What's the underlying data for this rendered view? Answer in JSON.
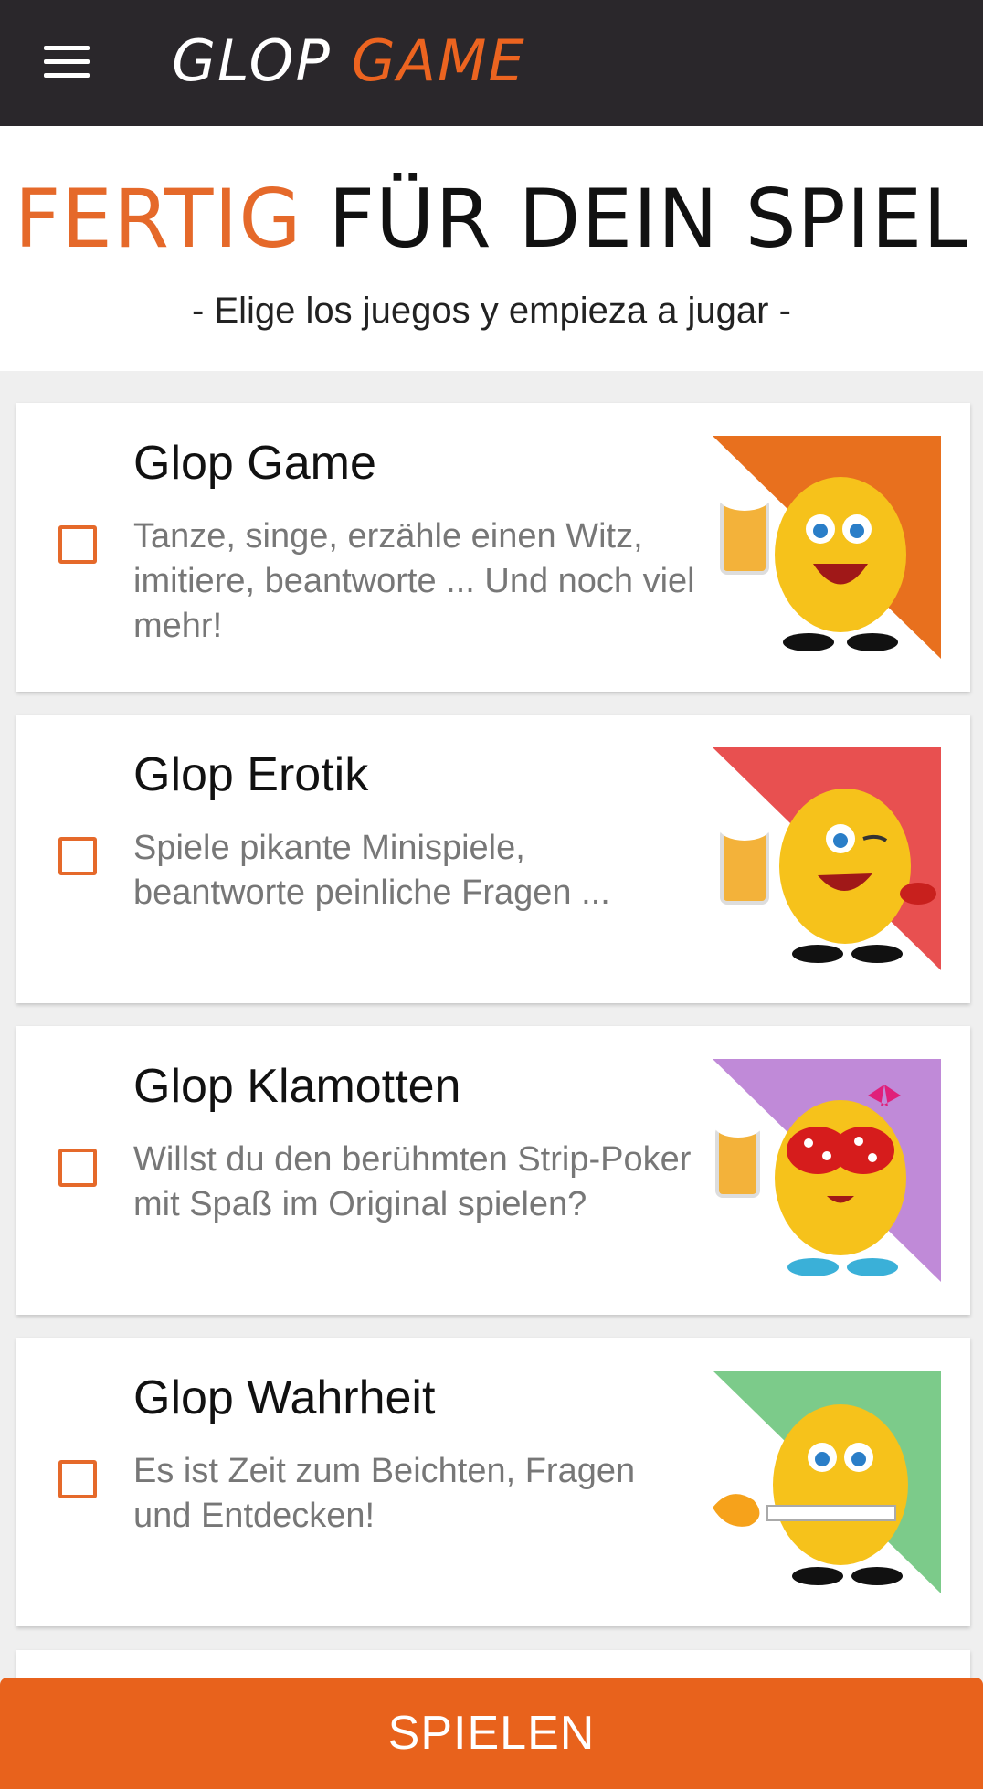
{
  "app": {
    "logo_white": "GLOP",
    "logo_orange": "GAME"
  },
  "header": {
    "title_highlight": "FERTIG",
    "title_rest": "FÜR DEIN SPIEL",
    "subtitle": "- Elige los juegos y empieza a jugar -"
  },
  "games": [
    {
      "title": "Glop Game",
      "desc": "Tanze, singe, erzähle einen Witz, imitiere, beantworte ... Und noch viel mehr!",
      "color": "#e8701e",
      "checked": false
    },
    {
      "title": "Glop Erotik",
      "desc": "Spiele pikante Minispiele, beantworte peinliche Fragen ...",
      "color": "#e85050",
      "checked": false
    },
    {
      "title": "Glop Klamotten",
      "desc": "Willst du den berühmten Strip-Poker mit Spaß im Original spielen?",
      "color": "#c08ad8",
      "checked": false
    },
    {
      "title": "Glop Wahrheit",
      "desc": "Es ist Zeit zum Beichten, Fragen und Entdecken!",
      "color": "#7ccb8a",
      "checked": false
    }
  ],
  "footer": {
    "play_label": "SPIELEN"
  }
}
